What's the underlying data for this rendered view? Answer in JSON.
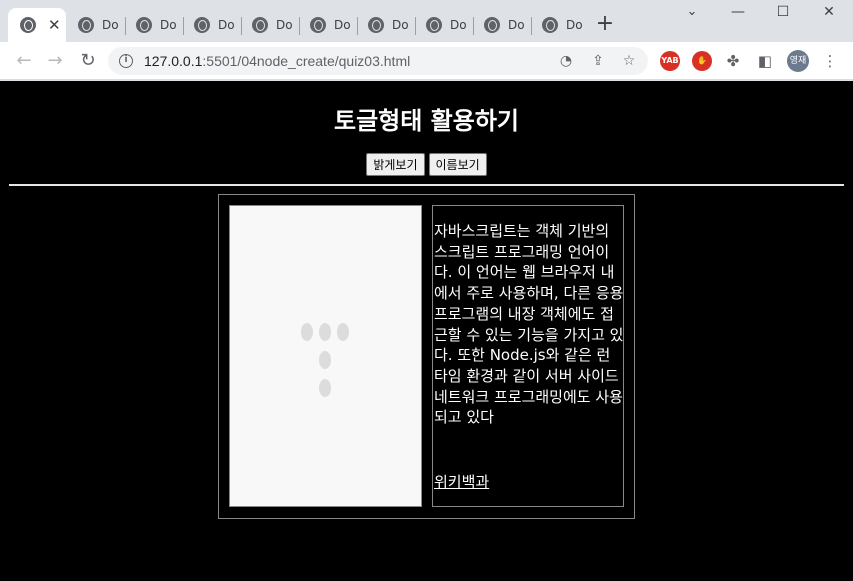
{
  "browser": {
    "tabs": [
      {
        "title": "",
        "active": true
      },
      {
        "title": "Do"
      },
      {
        "title": "Do"
      },
      {
        "title": "Do"
      },
      {
        "title": "Do"
      },
      {
        "title": "Do"
      },
      {
        "title": "Do"
      },
      {
        "title": "Do"
      },
      {
        "title": "Do"
      },
      {
        "title": "Do"
      }
    ],
    "active_tab_close": "✕",
    "new_tab": "+",
    "window_controls": {
      "minimize": "—",
      "maximize": "☐",
      "close": "✕"
    },
    "url_host": "127.0.0.1",
    "url_path": ":5501/04node_create/quiz03.html",
    "extensions": [
      {
        "name": "yab-extension-icon",
        "label": "YAB",
        "color": "#d93025"
      },
      {
        "name": "adblock-extension-icon",
        "label": "✋",
        "color": "#d93025"
      }
    ],
    "profile_label": "영재"
  },
  "page": {
    "title": "토글형태 활용하기",
    "buttons": {
      "bright": "밝게보기",
      "name": "이름보기"
    },
    "description": "자바스크립트는 객체 기반의 스크립트 프로그래밍 언어이다. 이 언어는 웹 브라우저 내에서 주로 사용하며, 다른 응용 프로그램의 내장 객체에도 접근할 수 있는 기능을 가지고 있다. 또한 Node.js와 같은 런타임 환경과 같이 서버 사이드 네트워크 프로그래밍에도 사용되고 있다",
    "link_text": "위키백과"
  }
}
